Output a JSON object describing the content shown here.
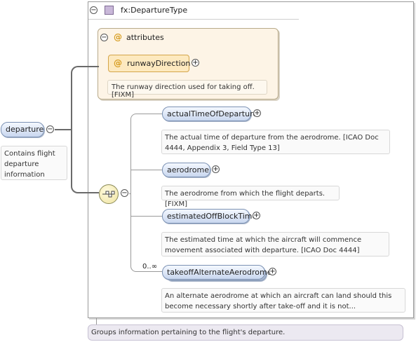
{
  "root_element": {
    "name": "departure",
    "doc": [
      "Contains flight",
      "departure",
      "information"
    ]
  },
  "type": {
    "name": "fx:DepartureType",
    "doc": "Groups information pertaining to the flight's departure."
  },
  "attributes": {
    "label": "attributes",
    "at_symbol": "@",
    "items": [
      {
        "name": "runwayDirection",
        "doc": "The runway direction used for taking off. [FIXM]"
      }
    ]
  },
  "sequence": {
    "icon": "sequence-compositor-icon",
    "elements": [
      {
        "name": "actualTimeOfDeparture",
        "doc": [
          "The actual time of departure from the aerodrome. [ICAO Doc",
          "4444, Appendix 3, Field Type 13]"
        ]
      },
      {
        "name": "aerodrome",
        "doc": [
          "The aerodrome from which the flight departs. [FIXM]"
        ]
      },
      {
        "name": "estimatedOffBlockTime",
        "doc": [
          "The estimated time at which the aircraft will commence",
          "movement associated with departure. [ICAO Doc 4444]"
        ]
      },
      {
        "name": "takeoffAlternateAerodrome",
        "cardinality": "0..∞",
        "doc": [
          "An alternate aerodrome at which an aircraft can land should this",
          "become necessary shortly after take-off and it is not..."
        ]
      }
    ]
  },
  "controls": {
    "collapse": "−",
    "expand": "+"
  },
  "colors": {
    "element_pill": "#c9d7ef",
    "attribute_pill": "#fde9bf",
    "attribute_group": "#fdf4e6",
    "type_icon": "#c9b8d9",
    "type_doc_bg": "#ece9f1"
  }
}
